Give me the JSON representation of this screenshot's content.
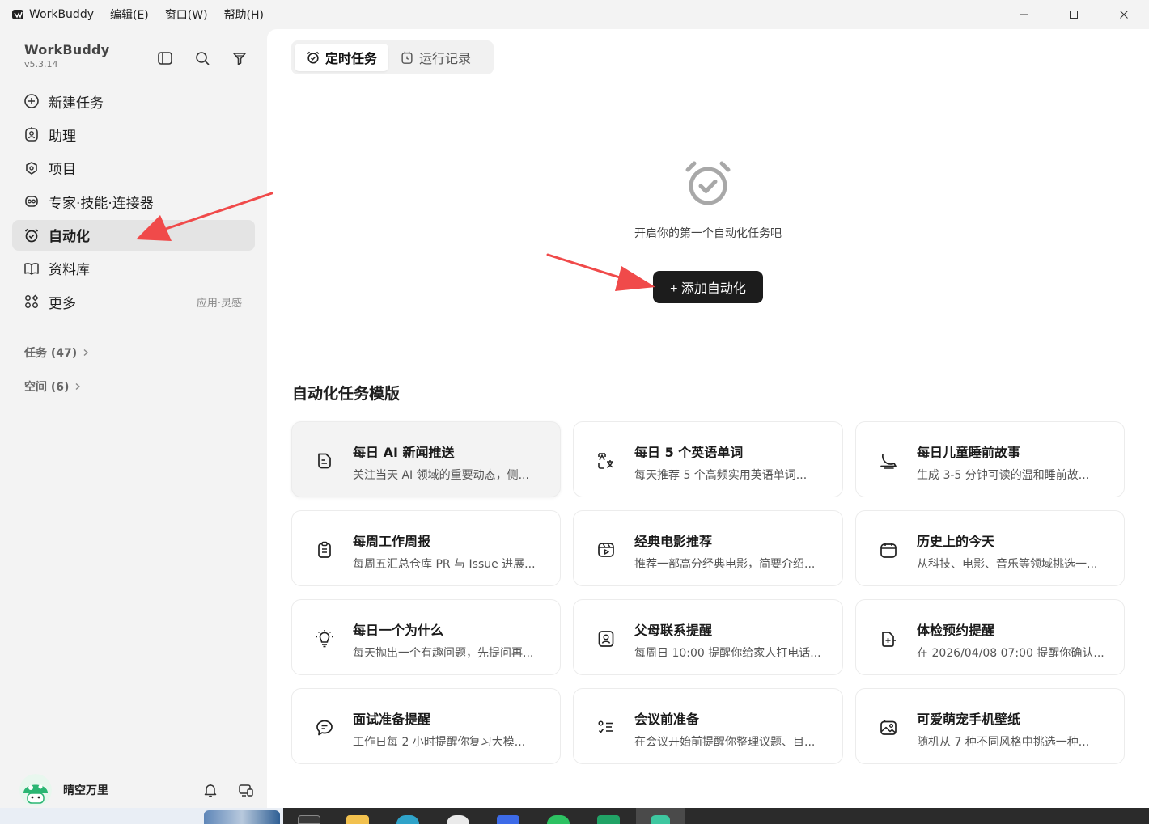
{
  "titlebar": {
    "app_name": "WorkBuddy",
    "menus": [
      "编辑(E)",
      "窗口(W)",
      "帮助(H)"
    ]
  },
  "sidebar": {
    "brand_name": "WorkBuddy",
    "version": "v5.3.14",
    "nav": [
      {
        "label": "新建任务",
        "icon": "plus-circle-icon"
      },
      {
        "label": "助理",
        "icon": "assistant-icon"
      },
      {
        "label": "项目",
        "icon": "project-icon"
      },
      {
        "label": "专家·技能·连接器",
        "icon": "connector-icon"
      },
      {
        "label": "自动化",
        "icon": "alarm-clock-icon",
        "active": true
      },
      {
        "label": "资料库",
        "icon": "book-icon"
      },
      {
        "label": "更多",
        "icon": "grid-more-icon",
        "extra": "应用·灵感"
      }
    ],
    "tasks_link": "任务 (47)",
    "spaces_link": "空间 (6)",
    "user_name": "晴空万里"
  },
  "main": {
    "tabs": [
      {
        "label": "定时任务",
        "active": true
      },
      {
        "label": "运行记录",
        "active": false
      }
    ],
    "empty_text": "开启你的第一个自动化任务吧",
    "add_button": "+ 添加自动化",
    "templates_title": "自动化任务模版",
    "templates": [
      {
        "title": "每日 AI 新闻推送",
        "desc": "关注当天 AI 领域的重要动态，侧...",
        "icon": "news-icon"
      },
      {
        "title": "每日 5 个英语单词",
        "desc": "每天推荐 5 个高频实用英语单词...",
        "icon": "translate-icon"
      },
      {
        "title": "每日儿童睡前故事",
        "desc": "生成 3-5 分钟可读的温和睡前故...",
        "icon": "moon-icon"
      },
      {
        "title": "每周工作周报",
        "desc": "每周五汇总仓库 PR 与 Issue 进展...",
        "icon": "clipboard-icon"
      },
      {
        "title": "经典电影推荐",
        "desc": "推荐一部高分经典电影，简要介绍...",
        "icon": "film-icon"
      },
      {
        "title": "历史上的今天",
        "desc": "从科技、电影、音乐等领域挑选一...",
        "icon": "calendar-icon"
      },
      {
        "title": "每日一个为什么",
        "desc": "每天抛出一个有趣问题，先提问再...",
        "icon": "lightbulb-icon"
      },
      {
        "title": "父母联系提醒",
        "desc": "每周日 10:00 提醒你给家人打电话...",
        "icon": "contact-icon"
      },
      {
        "title": "体检预约提醒",
        "desc": "在 2026/04/08 07:00 提醒你确认...",
        "icon": "medical-icon"
      },
      {
        "title": "面试准备提醒",
        "desc": "工作日每 2 小时提醒你复习大模...",
        "icon": "chat-icon"
      },
      {
        "title": "会议前准备",
        "desc": "在会议开始前提醒你整理议题、目...",
        "icon": "checklist-icon"
      },
      {
        "title": "可爱萌宠手机壁纸",
        "desc": "随机从 7 种不同风格中挑选一种...",
        "icon": "image-icon"
      }
    ]
  },
  "colors": {
    "sidebar_bg": "#f3f3f3",
    "active_nav_bg": "#e4e4e4",
    "primary_button": "#1c1c1c",
    "annotation_arrow": "#f04a4a"
  }
}
